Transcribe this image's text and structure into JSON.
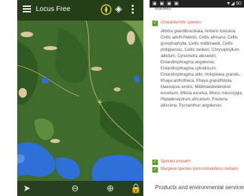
{
  "left_screen": {
    "app_title": "Locus Free",
    "icons": {
      "menu": "menu-icon",
      "compass": "compass-icon",
      "layers": "layers-icon",
      "more": "more-vert-icon",
      "crosshair": "crosshair-icon",
      "gps": "gps-icon",
      "zoom_out": "zoom-out-icon",
      "zoom_in": "zoom-in-icon",
      "lock": "lock-icon"
    },
    "glyphs": {
      "layers": "◈",
      "crosshair": "+",
      "gps": "➤",
      "zoom_out": "⊖",
      "zoom_in": "⊕",
      "lock": "🔒"
    },
    "colors": {
      "forest": "#3f6b2c",
      "water": "#2f6fd8",
      "sand": "#d9c9a0"
    }
  },
  "right_screen": {
    "status_left": "▣ ▣ ▣ ▣",
    "status_right": "▼◢ 90",
    "cut_heading": "brackets",
    "characteristic_label": "Characteristic species",
    "characteristic_species": "Albizia grandibracteata, Antiaris toxicaria, Celtis adolfi-friderici, Celtis africana, Celtis gomphophylla, Celtis mildbraedii, Celtis philippensis, Celtis zenkeri, Chrysophyllum albidum, Cynometra alexandri, Entandrophragma angolense, Entandrophragma cylindricum, Entandrophragma utile, Holoptelea grandis, Khaya anthotheca, Khaya grandifoliola, Maesopsis eminii, Mildbraediodendron excelsum, Milicia excelsa, Morus mesozygia, Piptadeniastrum africanum, Pouteria altissima, Pycnanthus angolensis",
    "species_present_label": "Species present",
    "marginal_species_label": "Marginal species (uncommon/less certain)",
    "products_heading": "Products and environmental services",
    "check_glyph": "✓"
  }
}
